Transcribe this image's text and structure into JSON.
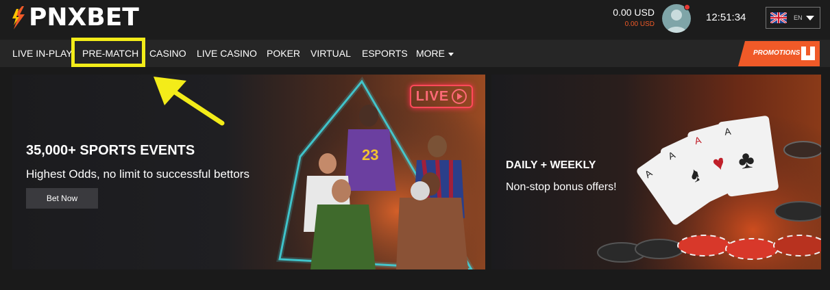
{
  "header": {
    "logo_text": "PNXBET",
    "balance_main": "0.00 USD",
    "balance_sub": "0.00 USD",
    "clock": "12:51:34",
    "language_code": "EN"
  },
  "nav": {
    "items": [
      "LIVE IN-PLAY",
      "PRE-MATCH",
      "CASINO",
      "LIVE CASINO",
      "POKER",
      "VIRTUAL",
      "ESPORTS",
      "MORE"
    ],
    "promotions_label": "PROMOTIONS"
  },
  "banners": {
    "sports": {
      "title": "35,000+ SPORTS EVENTS",
      "subtitle": "Highest Odds, no limit to successful bettors",
      "button": "Bet Now",
      "live_sign": "LIVE"
    },
    "casino": {
      "title": "DAILY + WEEKLY",
      "subtitle": "Non-stop bonus offers!"
    }
  },
  "colors": {
    "accent": "#f05a28",
    "highlight": "#f3ec19",
    "live_neon": "#ff4a5a"
  },
  "icons": {
    "logo": "pnxbet-flame-logo",
    "avatar": "user-avatar",
    "language_flag": "uk-flag-icon",
    "dropdown": "chevron-down-icon",
    "promotions": "gift-icon",
    "annotation": "arrow-annotation"
  }
}
